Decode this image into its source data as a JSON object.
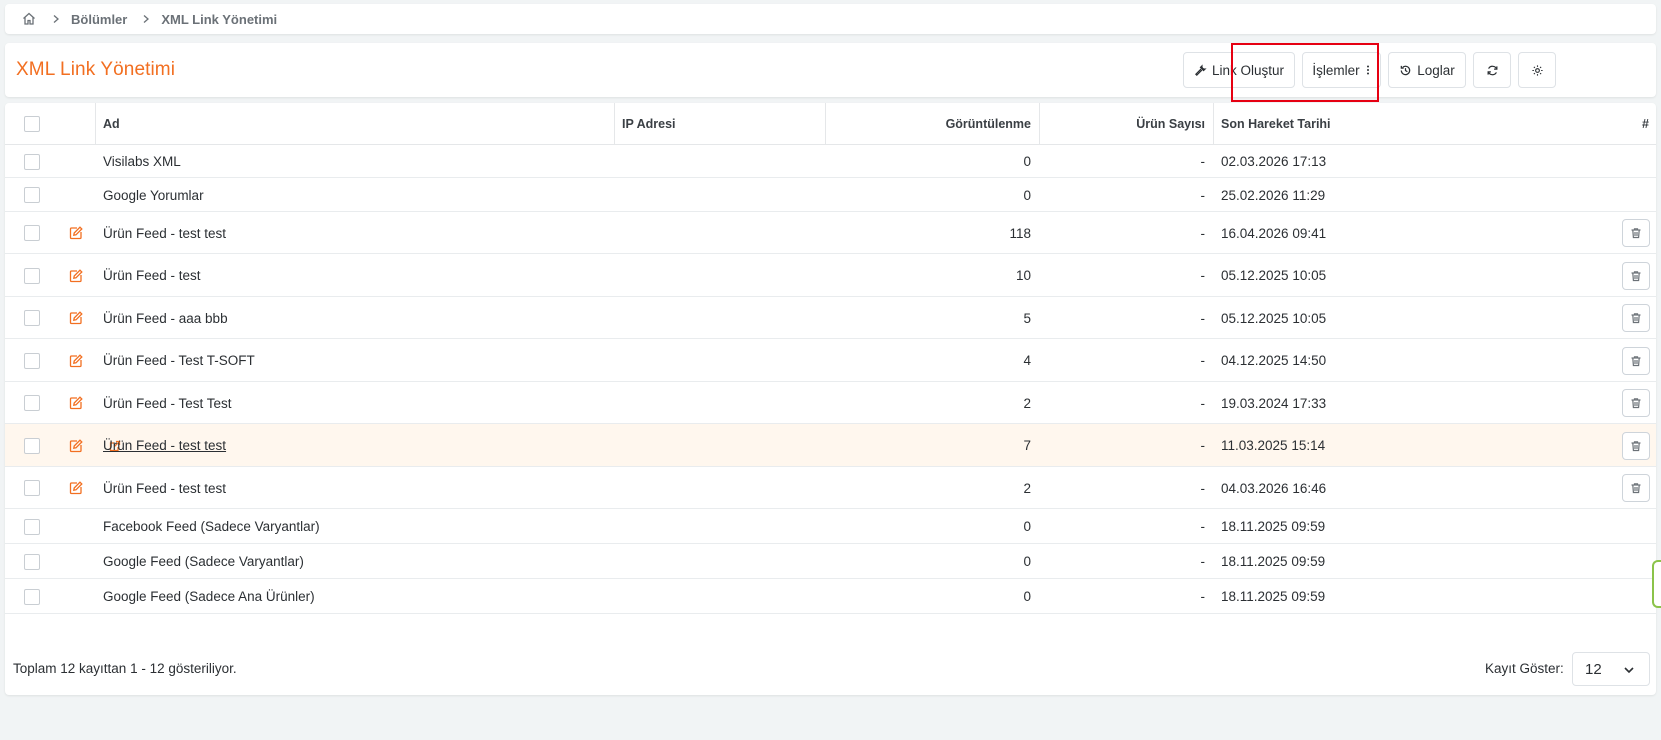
{
  "breadcrumb": {
    "items": [
      "Bölümler",
      "XML Link Yönetimi"
    ]
  },
  "header": {
    "title": "XML Link Yönetimi",
    "create_label": "Link Oluştur",
    "actions_label": "İşlemler",
    "logs_label": "Loglar"
  },
  "colors": {
    "accent": "#f26f21",
    "highlight_box": "#e60012"
  },
  "table": {
    "columns": {
      "name": "Ad",
      "ip": "IP Adresi",
      "views": "Görüntülenme",
      "products": "Ürün Sayısı",
      "last": "Son Hareket Tarihi",
      "hash": "#"
    },
    "rows": [
      {
        "name": "Visilabs XML",
        "views": "0",
        "products": "-",
        "last": "02.03.2026 17:13"
      },
      {
        "name": "Google Yorumlar",
        "views": "0",
        "products": "-",
        "last": "25.02.2026 11:29"
      },
      {
        "name": "Ürün Feed - test test",
        "views": "118",
        "products": "-",
        "last": "16.04.2026 09:41"
      },
      {
        "name": "Ürün Feed - test",
        "views": "10",
        "products": "-",
        "last": "05.12.2025 10:05"
      },
      {
        "name": "Ürün Feed - aaa bbb",
        "views": "5",
        "products": "-",
        "last": "05.12.2025 10:05"
      },
      {
        "name": "Ürün Feed - Test T-SOFT",
        "views": "4",
        "products": "-",
        "last": "04.12.2025 14:50"
      },
      {
        "name": "Ürün Feed - Test Test",
        "views": "2",
        "products": "-",
        "last": "19.03.2024 17:33"
      },
      {
        "name": "Ürün Feed - test test",
        "views": "7",
        "products": "-",
        "last": "11.03.2025 15:14"
      },
      {
        "name": "Ürün Feed - test test",
        "views": "2",
        "products": "-",
        "last": "04.03.2026 16:46"
      },
      {
        "name": "Facebook Feed (Sadece Varyantlar)",
        "views": "0",
        "products": "-",
        "last": "18.11.2025 09:59"
      },
      {
        "name": "Google Feed (Sadece Varyantlar)",
        "views": "0",
        "products": "-",
        "last": "18.11.2025 09:59"
      },
      {
        "name": "Google Feed (Sadece Ana Ürünler)",
        "views": "0",
        "products": "-",
        "last": "18.11.2025 09:59"
      }
    ]
  },
  "footer": {
    "info": "Toplam 12 kayıttan 1 - 12 gösteriliyor.",
    "page_size_label": "Kayıt Göster:",
    "page_size_value": "12"
  }
}
